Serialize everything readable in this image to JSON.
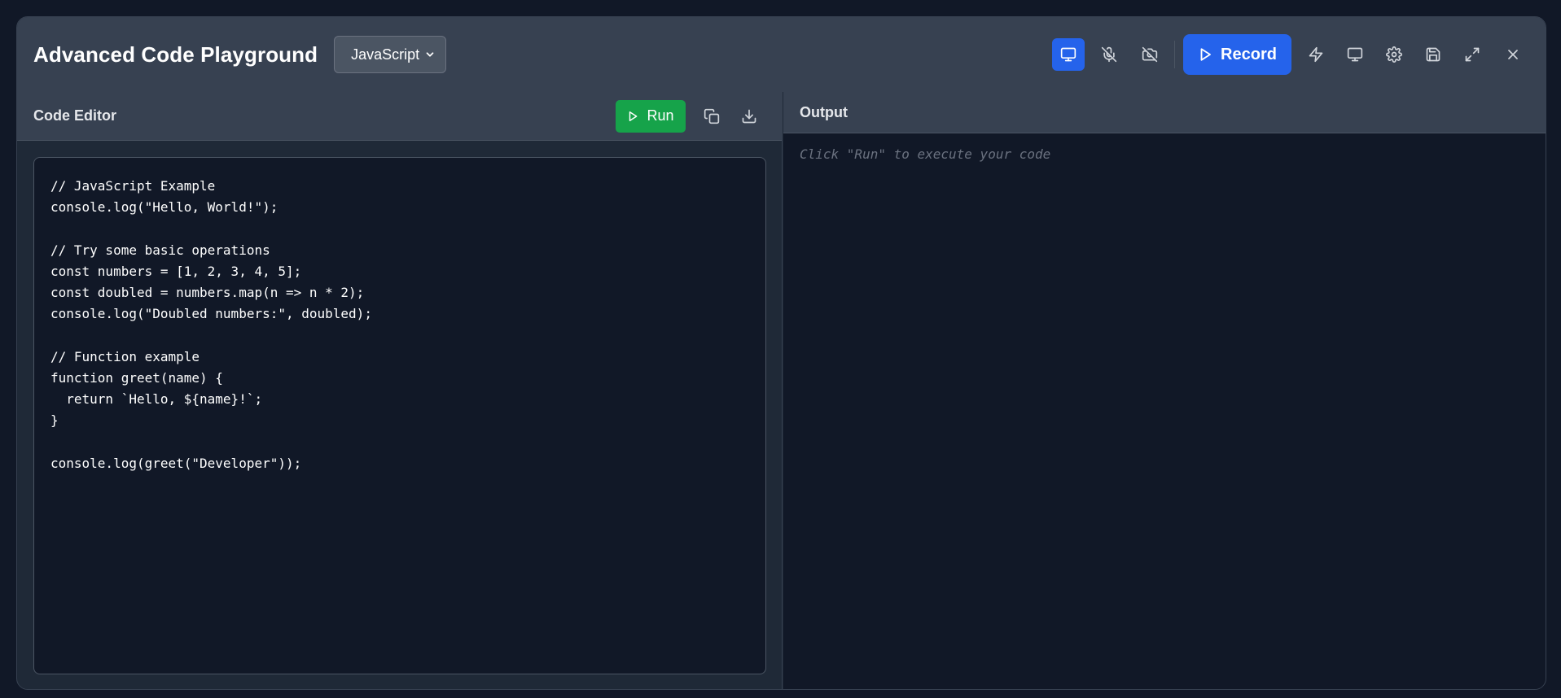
{
  "header": {
    "title": "Advanced Code Playground",
    "language_selected": "JavaScript",
    "record_label": "Record"
  },
  "editor": {
    "title": "Code Editor",
    "run_label": "Run",
    "code": "// JavaScript Example\nconsole.log(\"Hello, World!\");\n\n// Try some basic operations\nconst numbers = [1, 2, 3, 4, 5];\nconst doubled = numbers.map(n => n * 2);\nconsole.log(\"Doubled numbers:\", doubled);\n\n// Function example\nfunction greet(name) {\n  return `Hello, ${name}!`;\n}\n\nconsole.log(greet(\"Developer\"));"
  },
  "output": {
    "title": "Output",
    "placeholder": "Click \"Run\" to execute your code"
  },
  "colors": {
    "accent": "#2563eb",
    "run": "#16a34a",
    "background": "#111827",
    "panel": "#374151"
  },
  "icons": {
    "screen_toggle": "monitor-icon",
    "mic": "mic-off-icon",
    "camera": "camera-off-icon",
    "record": "play-icon",
    "lightning": "zap-icon",
    "display": "monitor-icon",
    "settings": "gear-icon",
    "save": "save-icon",
    "fullscreen": "maximize-icon",
    "close": "close-icon",
    "copy": "copy-icon",
    "download": "download-icon"
  }
}
